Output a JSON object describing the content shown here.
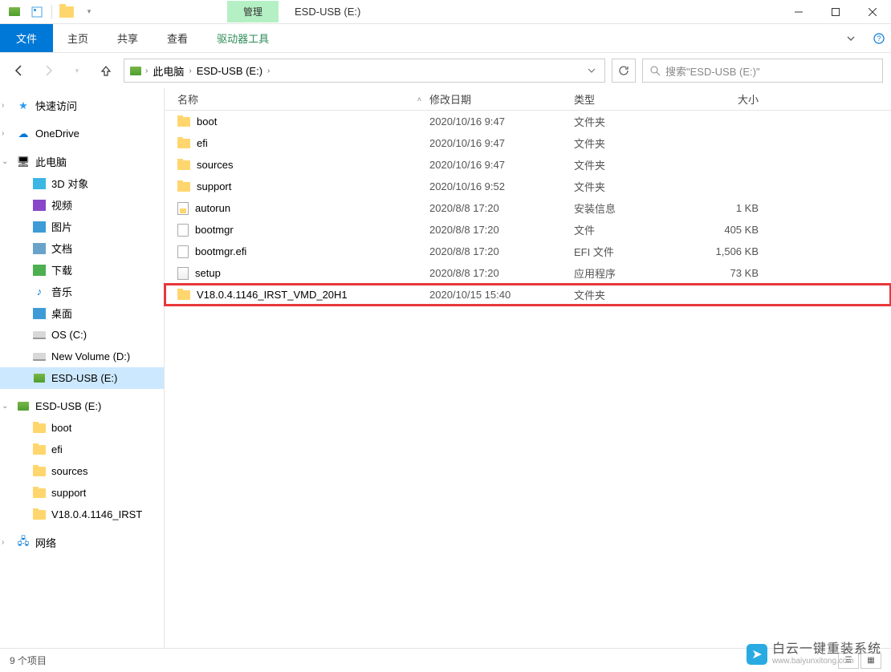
{
  "titlebar": {
    "manage_label": "管理",
    "window_title": "ESD-USB (E:)"
  },
  "ribbon": {
    "file": "文件",
    "home": "主页",
    "share": "共享",
    "view": "查看",
    "drive_tools": "驱动器工具"
  },
  "breadcrumb": {
    "root": "此电脑",
    "current": "ESD-USB (E:)"
  },
  "search": {
    "placeholder": "搜索\"ESD-USB (E:)\""
  },
  "sidebar": {
    "quick_access": "快速访问",
    "onedrive": "OneDrive",
    "this_pc": "此电脑",
    "items_pc": [
      {
        "label": "3D 对象",
        "icon": "3d"
      },
      {
        "label": "视频",
        "icon": "video"
      },
      {
        "label": "图片",
        "icon": "pic"
      },
      {
        "label": "文档",
        "icon": "doc"
      },
      {
        "label": "下载",
        "icon": "dl"
      },
      {
        "label": "音乐",
        "icon": "music"
      },
      {
        "label": "桌面",
        "icon": "desk"
      },
      {
        "label": "OS (C:)",
        "icon": "drive"
      },
      {
        "label": "New Volume (D:)",
        "icon": "drive"
      },
      {
        "label": "ESD-USB (E:)",
        "icon": "usb",
        "selected": true
      }
    ],
    "usb_root": "ESD-USB (E:)",
    "usb_items": [
      {
        "label": "boot"
      },
      {
        "label": "efi"
      },
      {
        "label": "sources"
      },
      {
        "label": "support"
      },
      {
        "label": "V18.0.4.1146_IRST"
      }
    ],
    "network": "网络"
  },
  "columns": {
    "name": "名称",
    "date": "修改日期",
    "type": "类型",
    "size": "大小"
  },
  "files": [
    {
      "name": "boot",
      "date": "2020/10/16 9:47",
      "type": "文件夹",
      "size": "",
      "icon": "folder"
    },
    {
      "name": "efi",
      "date": "2020/10/16 9:47",
      "type": "文件夹",
      "size": "",
      "icon": "folder"
    },
    {
      "name": "sources",
      "date": "2020/10/16 9:47",
      "type": "文件夹",
      "size": "",
      "icon": "folder"
    },
    {
      "name": "support",
      "date": "2020/10/16 9:52",
      "type": "文件夹",
      "size": "",
      "icon": "folder"
    },
    {
      "name": "autorun",
      "date": "2020/8/8 17:20",
      "type": "安装信息",
      "size": "1 KB",
      "icon": "inf"
    },
    {
      "name": "bootmgr",
      "date": "2020/8/8 17:20",
      "type": "文件",
      "size": "405 KB",
      "icon": "file"
    },
    {
      "name": "bootmgr.efi",
      "date": "2020/8/8 17:20",
      "type": "EFI 文件",
      "size": "1,506 KB",
      "icon": "file"
    },
    {
      "name": "setup",
      "date": "2020/8/8 17:20",
      "type": "应用程序",
      "size": "73 KB",
      "icon": "app"
    },
    {
      "name": "V18.0.4.1146_IRST_VMD_20H1",
      "date": "2020/10/15 15:40",
      "type": "文件夹",
      "size": "",
      "icon": "folder",
      "highlighted": true
    }
  ],
  "statusbar": {
    "item_count": "9 个项目"
  },
  "watermark": {
    "text": "白云一键重装系统",
    "sub": "www.baiyunxitong.com"
  }
}
